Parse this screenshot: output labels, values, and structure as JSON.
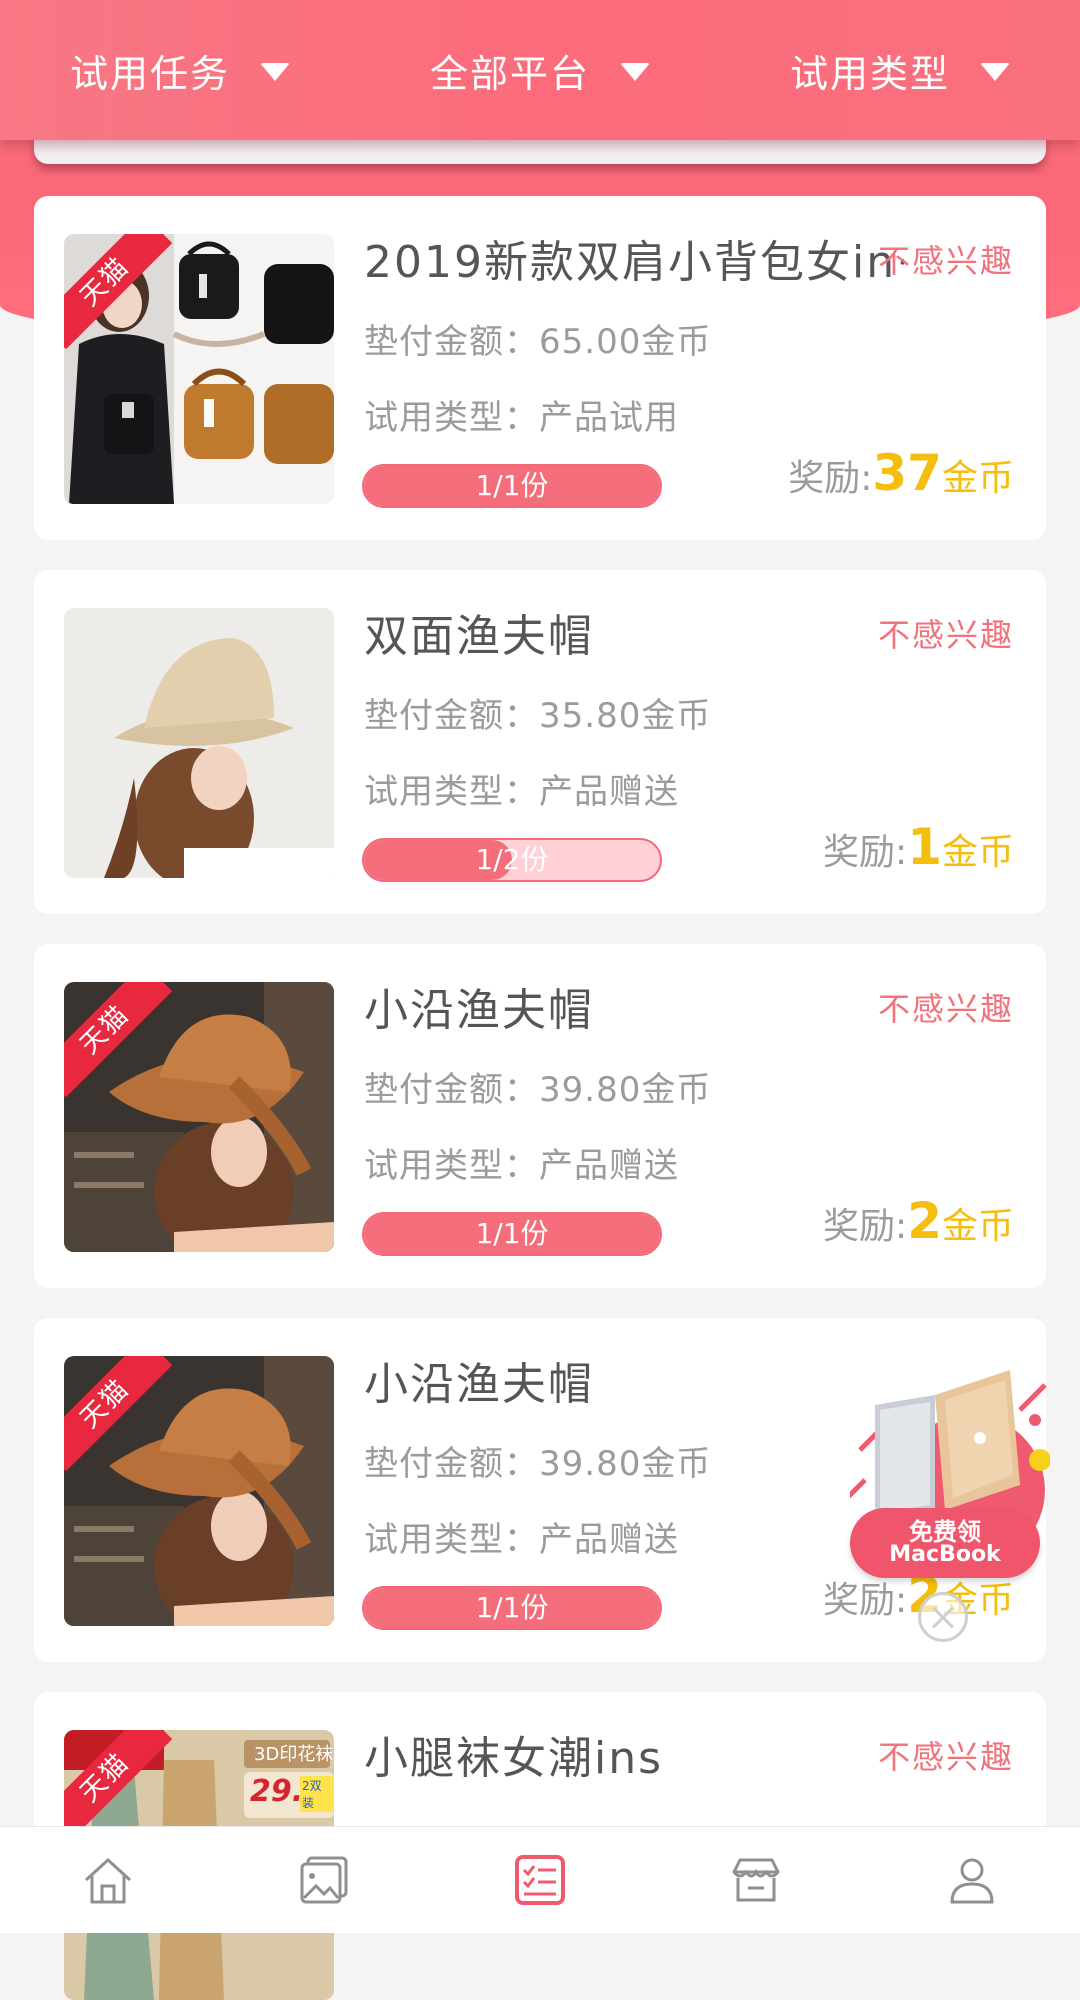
{
  "filters": [
    {
      "label": "试用任务"
    },
    {
      "label": "全部平台"
    },
    {
      "label": "试用类型"
    }
  ],
  "items": [
    {
      "tag": "天猫",
      "title": "2019新款双肩小背包女in···",
      "not_interested": "不感兴趣",
      "deposit": "垫付金额：65.00金币",
      "trial_type": "试用类型：产品试用",
      "progress_text": "1/1份",
      "progress_fraction": 1.0,
      "reward_label": "奖励:",
      "reward_amount": "37",
      "reward_unit": "金币"
    },
    {
      "tag": "",
      "title": "双面渔夫帽",
      "not_interested": "不感兴趣",
      "deposit": "垫付金额：35.80金币",
      "trial_type": "试用类型：产品赠送",
      "progress_text": "1/2份",
      "progress_fraction": 0.5,
      "reward_label": "奖励:",
      "reward_amount": "1",
      "reward_unit": "金币"
    },
    {
      "tag": "天猫",
      "title": "小沿渔夫帽",
      "not_interested": "不感兴趣",
      "deposit": "垫付金额：39.80金币",
      "trial_type": "试用类型：产品赠送",
      "progress_text": "1/1份",
      "progress_fraction": 1.0,
      "reward_label": "奖励:",
      "reward_amount": "2",
      "reward_unit": "金币"
    },
    {
      "tag": "天猫",
      "title": "小沿渔夫帽",
      "not_interested": "",
      "deposit": "垫付金额：39.80金币",
      "trial_type": "试用类型：产品赠送",
      "progress_text": "1/1份",
      "progress_fraction": 1.0,
      "reward_label": "奖励:",
      "reward_amount": "2",
      "reward_unit": "金币"
    },
    {
      "tag": "天猫",
      "title": "小腿袜女潮ins",
      "not_interested": "不感兴趣",
      "thumb_caption": "3D印花袜",
      "thumb_price": "29.9",
      "thumb_badge": "2双装"
    }
  ],
  "promo": {
    "line1": "免费领",
    "line2": "MacBook"
  },
  "bottom_nav": [
    {
      "icon": "home-icon",
      "active": false
    },
    {
      "icon": "gallery-icon",
      "active": false
    },
    {
      "icon": "task-list-icon",
      "active": true
    },
    {
      "icon": "store-icon",
      "active": false
    },
    {
      "icon": "profile-icon",
      "active": false
    }
  ],
  "colors": {
    "brand": "#f36d7a",
    "accent_gold": "#f5bd0d",
    "text_gray": "#9b9b9b"
  }
}
